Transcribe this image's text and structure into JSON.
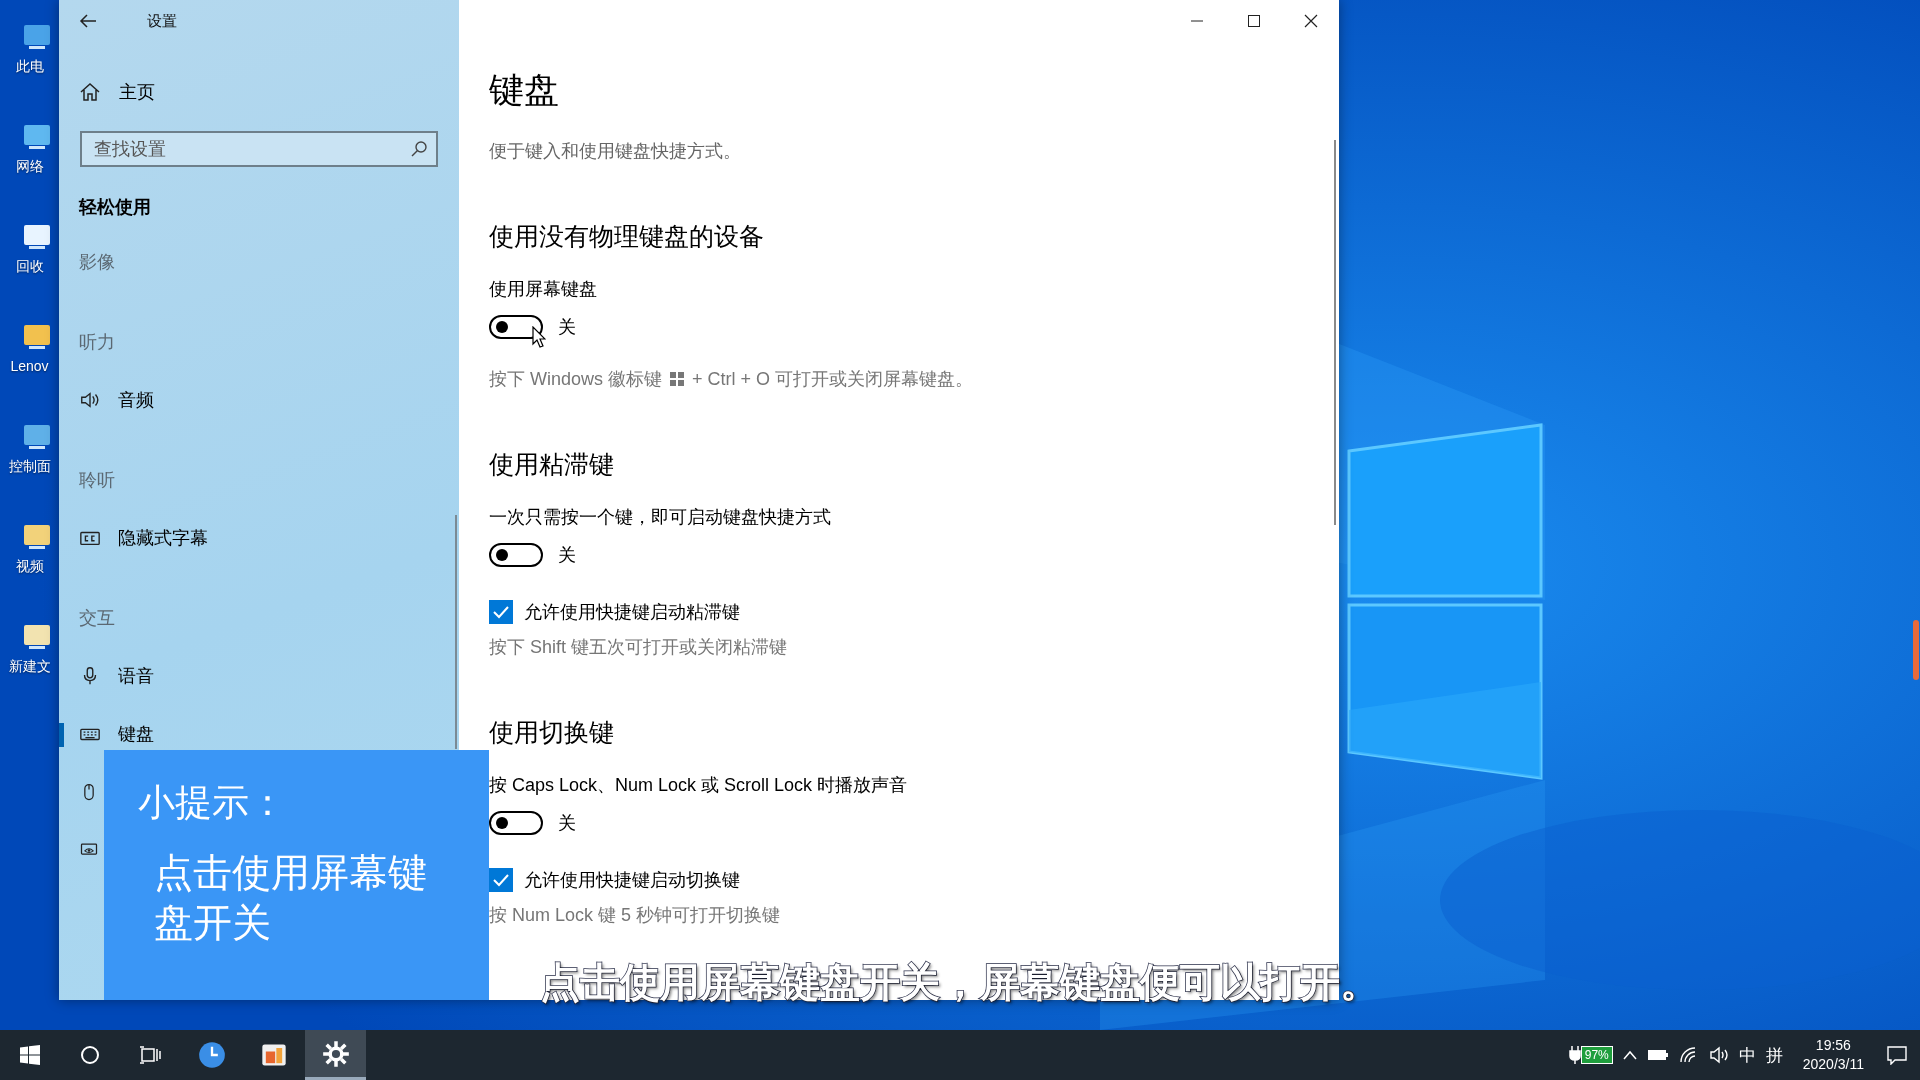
{
  "desktop_icons": [
    {
      "label": "此电"
    },
    {
      "label": "网络"
    },
    {
      "label": "回收"
    },
    {
      "label": "Lenov"
    },
    {
      "label": "控制面"
    },
    {
      "label": "视频"
    },
    {
      "label": "新建文"
    }
  ],
  "window": {
    "title": "设置"
  },
  "sidebar": {
    "home": "主页",
    "search": {
      "placeholder": "查找设置"
    },
    "category": "轻松使用",
    "items": [
      {
        "kind": "header",
        "label": "影像"
      },
      {
        "kind": "header",
        "label": "听力"
      },
      {
        "kind": "link",
        "label": "音频",
        "selected": false
      },
      {
        "kind": "header",
        "label": "聆听"
      },
      {
        "kind": "link",
        "label": "隐藏式字幕",
        "selected": false
      },
      {
        "kind": "header",
        "label": "交互"
      },
      {
        "kind": "link",
        "label": "语音",
        "selected": false
      },
      {
        "kind": "link",
        "label": "键盘",
        "selected": true
      },
      {
        "kind": "link",
        "selected": false
      },
      {
        "kind": "link",
        "selected": false
      }
    ]
  },
  "page": {
    "title": "键盘",
    "description": "便于键入和使用键盘快捷方式。",
    "sections": [
      {
        "heading": "使用没有物理键盘的设备",
        "settings": [
          {
            "kind": "toggle",
            "label": "使用屏幕键盘",
            "on": false,
            "state_text": "关"
          },
          {
            "kind": "logo_hint",
            "parts": [
              "按下 Windows 徽标键",
              "+ Ctrl + O 可打开或关闭屏幕键盘。"
            ]
          }
        ]
      },
      {
        "heading": "使用粘滞键",
        "settings": [
          {
            "kind": "toggle",
            "label": "一次只需按一个键，即可启动键盘快捷方式",
            "on": false,
            "state_text": "关"
          },
          {
            "kind": "checkbox",
            "label": "允许使用快捷键启动粘滞键",
            "checked": true
          },
          {
            "kind": "hint",
            "text": "按下 Shift 键五次可打开或关闭粘滞键"
          }
        ]
      },
      {
        "heading": "使用切换键",
        "settings": [
          {
            "kind": "toggle",
            "label": "按 Caps Lock、Num Lock 或 Scroll Lock 时播放声音",
            "on": false,
            "state_text": "关"
          },
          {
            "kind": "checkbox",
            "label": "允许使用快捷键启动切换键",
            "checked": true
          },
          {
            "kind": "hint",
            "text": "按 Num Lock 键 5 秒钟可打开切换键"
          }
        ]
      }
    ]
  },
  "tip": {
    "title": "小提示：",
    "body": "点击使用屏幕键盘开关"
  },
  "subtitle": "点击使用屏幕键盘开关，屏幕键盘便可以打开。",
  "taskbar": {
    "apps": [
      {
        "selected": false
      },
      {
        "selected": false
      },
      {
        "selected": true
      }
    ],
    "tray": {
      "battery": "97%",
      "ime_mode": "中",
      "ime": "拼",
      "time": "19:56",
      "date": "2020/3/11"
    }
  }
}
